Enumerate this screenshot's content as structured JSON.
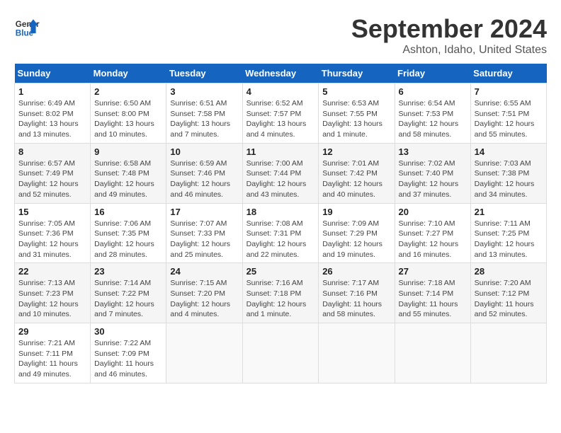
{
  "header": {
    "logo_line1": "General",
    "logo_line2": "Blue",
    "title": "September 2024",
    "subtitle": "Ashton, Idaho, United States"
  },
  "columns": [
    "Sunday",
    "Monday",
    "Tuesday",
    "Wednesday",
    "Thursday",
    "Friday",
    "Saturday"
  ],
  "weeks": [
    [
      {
        "num": "1",
        "detail": "Sunrise: 6:49 AM\nSunset: 8:02 PM\nDaylight: 13 hours\nand 13 minutes."
      },
      {
        "num": "2",
        "detail": "Sunrise: 6:50 AM\nSunset: 8:00 PM\nDaylight: 13 hours\nand 10 minutes."
      },
      {
        "num": "3",
        "detail": "Sunrise: 6:51 AM\nSunset: 7:58 PM\nDaylight: 13 hours\nand 7 minutes."
      },
      {
        "num": "4",
        "detail": "Sunrise: 6:52 AM\nSunset: 7:57 PM\nDaylight: 13 hours\nand 4 minutes."
      },
      {
        "num": "5",
        "detail": "Sunrise: 6:53 AM\nSunset: 7:55 PM\nDaylight: 13 hours\nand 1 minute."
      },
      {
        "num": "6",
        "detail": "Sunrise: 6:54 AM\nSunset: 7:53 PM\nDaylight: 12 hours\nand 58 minutes."
      },
      {
        "num": "7",
        "detail": "Sunrise: 6:55 AM\nSunset: 7:51 PM\nDaylight: 12 hours\nand 55 minutes."
      }
    ],
    [
      {
        "num": "8",
        "detail": "Sunrise: 6:57 AM\nSunset: 7:49 PM\nDaylight: 12 hours\nand 52 minutes."
      },
      {
        "num": "9",
        "detail": "Sunrise: 6:58 AM\nSunset: 7:48 PM\nDaylight: 12 hours\nand 49 minutes."
      },
      {
        "num": "10",
        "detail": "Sunrise: 6:59 AM\nSunset: 7:46 PM\nDaylight: 12 hours\nand 46 minutes."
      },
      {
        "num": "11",
        "detail": "Sunrise: 7:00 AM\nSunset: 7:44 PM\nDaylight: 12 hours\nand 43 minutes."
      },
      {
        "num": "12",
        "detail": "Sunrise: 7:01 AM\nSunset: 7:42 PM\nDaylight: 12 hours\nand 40 minutes."
      },
      {
        "num": "13",
        "detail": "Sunrise: 7:02 AM\nSunset: 7:40 PM\nDaylight: 12 hours\nand 37 minutes."
      },
      {
        "num": "14",
        "detail": "Sunrise: 7:03 AM\nSunset: 7:38 PM\nDaylight: 12 hours\nand 34 minutes."
      }
    ],
    [
      {
        "num": "15",
        "detail": "Sunrise: 7:05 AM\nSunset: 7:36 PM\nDaylight: 12 hours\nand 31 minutes."
      },
      {
        "num": "16",
        "detail": "Sunrise: 7:06 AM\nSunset: 7:35 PM\nDaylight: 12 hours\nand 28 minutes."
      },
      {
        "num": "17",
        "detail": "Sunrise: 7:07 AM\nSunset: 7:33 PM\nDaylight: 12 hours\nand 25 minutes."
      },
      {
        "num": "18",
        "detail": "Sunrise: 7:08 AM\nSunset: 7:31 PM\nDaylight: 12 hours\nand 22 minutes."
      },
      {
        "num": "19",
        "detail": "Sunrise: 7:09 AM\nSunset: 7:29 PM\nDaylight: 12 hours\nand 19 minutes."
      },
      {
        "num": "20",
        "detail": "Sunrise: 7:10 AM\nSunset: 7:27 PM\nDaylight: 12 hours\nand 16 minutes."
      },
      {
        "num": "21",
        "detail": "Sunrise: 7:11 AM\nSunset: 7:25 PM\nDaylight: 12 hours\nand 13 minutes."
      }
    ],
    [
      {
        "num": "22",
        "detail": "Sunrise: 7:13 AM\nSunset: 7:23 PM\nDaylight: 12 hours\nand 10 minutes."
      },
      {
        "num": "23",
        "detail": "Sunrise: 7:14 AM\nSunset: 7:22 PM\nDaylight: 12 hours\nand 7 minutes."
      },
      {
        "num": "24",
        "detail": "Sunrise: 7:15 AM\nSunset: 7:20 PM\nDaylight: 12 hours\nand 4 minutes."
      },
      {
        "num": "25",
        "detail": "Sunrise: 7:16 AM\nSunset: 7:18 PM\nDaylight: 12 hours\nand 1 minute."
      },
      {
        "num": "26",
        "detail": "Sunrise: 7:17 AM\nSunset: 7:16 PM\nDaylight: 11 hours\nand 58 minutes."
      },
      {
        "num": "27",
        "detail": "Sunrise: 7:18 AM\nSunset: 7:14 PM\nDaylight: 11 hours\nand 55 minutes."
      },
      {
        "num": "28",
        "detail": "Sunrise: 7:20 AM\nSunset: 7:12 PM\nDaylight: 11 hours\nand 52 minutes."
      }
    ],
    [
      {
        "num": "29",
        "detail": "Sunrise: 7:21 AM\nSunset: 7:11 PM\nDaylight: 11 hours\nand 49 minutes."
      },
      {
        "num": "30",
        "detail": "Sunrise: 7:22 AM\nSunset: 7:09 PM\nDaylight: 11 hours\nand 46 minutes."
      },
      null,
      null,
      null,
      null,
      null
    ]
  ]
}
